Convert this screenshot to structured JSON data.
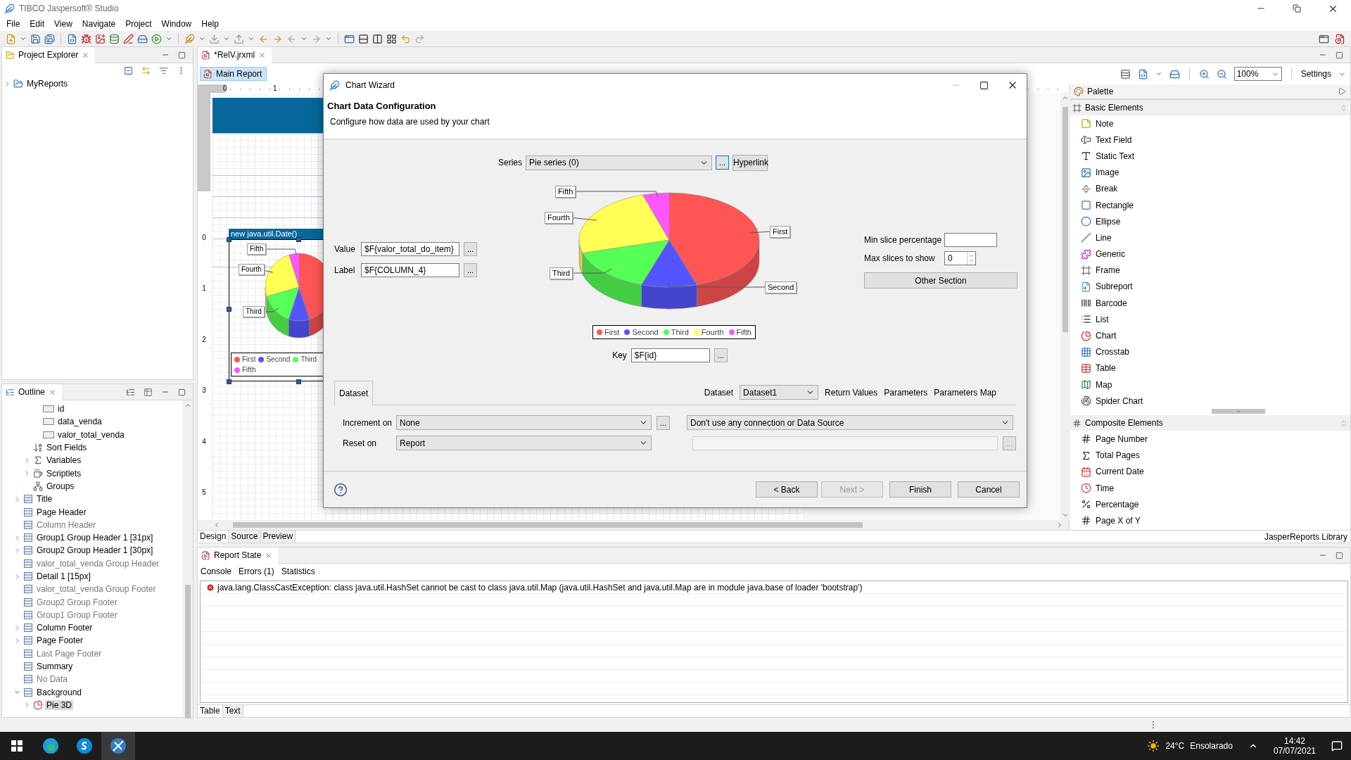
{
  "app": {
    "title": "TIBCO Jaspersoft® Studio"
  },
  "menu": [
    "File",
    "Edit",
    "View",
    "Navigate",
    "Project",
    "Window",
    "Help"
  ],
  "project_explorer": {
    "title": "Project Explorer",
    "items": [
      {
        "label": "MyReports",
        "expanded": false
      }
    ]
  },
  "outline": {
    "title": "Outline",
    "field_items": [
      "id",
      "data_venda",
      "valor_total_venda"
    ],
    "dataset_items": [
      {
        "label": "Sort Fields"
      },
      {
        "label": "Variables",
        "expanded": false
      },
      {
        "label": "Scriptlets",
        "expanded": false
      },
      {
        "label": "Groups"
      }
    ],
    "bands": [
      {
        "label": "Title",
        "expanded": false,
        "dimmed": false,
        "selected": false
      },
      {
        "label": "Page Header",
        "dimmed": false,
        "selected": false
      },
      {
        "label": "Column Header",
        "dimmed": true,
        "selected": false
      },
      {
        "label": "Group1 Group Header 1 [31px]",
        "expanded": false,
        "dimmed": false,
        "selected": false
      },
      {
        "label": "Group2 Group Header 1 [30px]",
        "expanded": false,
        "dimmed": false,
        "selected": false
      },
      {
        "label": "valor_total_venda Group Header",
        "dimmed": true,
        "selected": false
      },
      {
        "label": "Detail 1 [15px]",
        "expanded": false,
        "dimmed": false,
        "selected": false
      },
      {
        "label": "valor_total_venda Group Footer",
        "dimmed": true,
        "selected": false
      },
      {
        "label": "Group2 Group Footer",
        "dimmed": true,
        "selected": false
      },
      {
        "label": "Group1 Group Footer",
        "dimmed": true,
        "selected": false
      },
      {
        "label": "Column Footer",
        "expanded": false,
        "dimmed": false,
        "selected": false
      },
      {
        "label": "Page Footer",
        "expanded": false,
        "dimmed": false,
        "selected": false
      },
      {
        "label": "Last Page Footer",
        "dimmed": true,
        "selected": false
      },
      {
        "label": "Summary",
        "dimmed": false,
        "selected": false
      },
      {
        "label": "No Data",
        "dimmed": true,
        "selected": false
      },
      {
        "label": "Background",
        "expanded": true,
        "dimmed": false,
        "selected": false,
        "children": [
          {
            "label": "Pie 3D",
            "expanded": false,
            "dimmed": false,
            "selected": true
          }
        ]
      }
    ]
  },
  "editor": {
    "tabs": [
      {
        "label": "*RelV.jrxml",
        "selected": true
      }
    ],
    "page_tab": {
      "label": "Main Report",
      "selected": true
    },
    "zoom": "100%",
    "settings": "Settings",
    "ruler_h": [
      "0",
      "1"
    ],
    "ruler_v": [
      "0",
      "1",
      "2",
      "3",
      "4",
      "5"
    ],
    "canvas": {
      "chart_title": "new java.util.Date()",
      "slice_labels": [
        "Fifth",
        "Fourth",
        "Third"
      ],
      "legend": [
        {
          "label": "First",
          "color": "#ff5555"
        },
        {
          "label": "Second",
          "color": "#5555ff"
        },
        {
          "label": "Third",
          "color": "#55ff55"
        },
        {
          "label": "Fifth",
          "color": "#ff55ff"
        }
      ]
    },
    "view_tabs": [
      {
        "label": "Design",
        "selected": true
      },
      {
        "label": "Source",
        "selected": false
      },
      {
        "label": "Preview",
        "selected": false
      }
    ]
  },
  "palette": {
    "title": "Palette",
    "sections": [
      {
        "title": "Basic Elements",
        "items": [
          "Note",
          "Text Field",
          "Static Text",
          "Image",
          "Break",
          "Rectangle",
          "Ellipse",
          "Line",
          "Generic",
          "Frame",
          "Subreport",
          "Barcode",
          "List",
          "Chart",
          "Crosstab",
          "Table",
          "Map",
          "Spider Chart"
        ]
      },
      {
        "title": "Composite Elements",
        "items": [
          "Page Number",
          "Total Pages",
          "Current Date",
          "Time",
          "Percentage",
          "Page X of Y"
        ]
      }
    ],
    "footer": "JasperReports Library"
  },
  "report_state": {
    "title": "Report State",
    "tabs": [
      "Console",
      "Errors (1)",
      "Statistics"
    ],
    "errors": [
      "java.lang.ClassCastException: class java.util.HashSet cannot be cast to class java.util.Map (java.util.HashSet and java.util.Map are in module java.base of loader 'bootstrap')"
    ],
    "view_tabs": [
      {
        "label": "Table",
        "selected": true
      },
      {
        "label": "Text",
        "selected": false
      }
    ]
  },
  "dialog": {
    "title": "Chart Wizard",
    "heading": "Chart Data Configuration",
    "description": "Configure how data are used by your chart",
    "series": {
      "label": "Series",
      "value": "Pie series (0)",
      "more": "...",
      "hyperlink": "Hyperlink"
    },
    "value_field": {
      "label": "Value",
      "value": "$F{valor_total_do_item}",
      "more": "..."
    },
    "label_field": {
      "label": "Label",
      "value": "$F{COLUMN_4}",
      "more": "..."
    },
    "chart": {
      "slice_labels": [
        "Fifth",
        "Fourth",
        "Third",
        "First",
        "Second"
      ],
      "legend": [
        {
          "label": "First",
          "color": "#ff5555"
        },
        {
          "label": "Second",
          "color": "#5555ff"
        },
        {
          "label": "Third",
          "color": "#55ff55"
        },
        {
          "label": "Fourth",
          "color": "#ffff55"
        },
        {
          "label": "Fifth",
          "color": "#ff55ff"
        }
      ]
    },
    "key_field": {
      "label": "Key",
      "value": "$F{id}",
      "more": "..."
    },
    "min_slice": {
      "label": "Min slice percentage"
    },
    "max_slices": {
      "label": "Max slices to show",
      "value": "0"
    },
    "other_section": "Other Section",
    "tabs": [
      {
        "label": "Dataset",
        "selected": true
      }
    ],
    "dataset": {
      "label": "Dataset",
      "value": "Dataset1"
    },
    "links": [
      "Return Values",
      "Parameters",
      "Parameters Map"
    ],
    "increment": {
      "label": "Increment on",
      "value": "None",
      "more": "..."
    },
    "connection": {
      "value": "Don't use any connection or Data Source"
    },
    "reset": {
      "label": "Reset on",
      "value": "Report"
    },
    "expression": {
      "more": "...",
      "disabled": true
    },
    "buttons": [
      {
        "label": "< Back",
        "disabled": false
      },
      {
        "label": "Next >",
        "disabled": true
      },
      {
        "label": "Finish",
        "disabled": false
      },
      {
        "label": "Cancel",
        "disabled": false
      }
    ]
  },
  "taskbar": {
    "temperature": "24°C",
    "condition": "Ensolarado",
    "time": "14:42",
    "date": "07/07/2021"
  }
}
